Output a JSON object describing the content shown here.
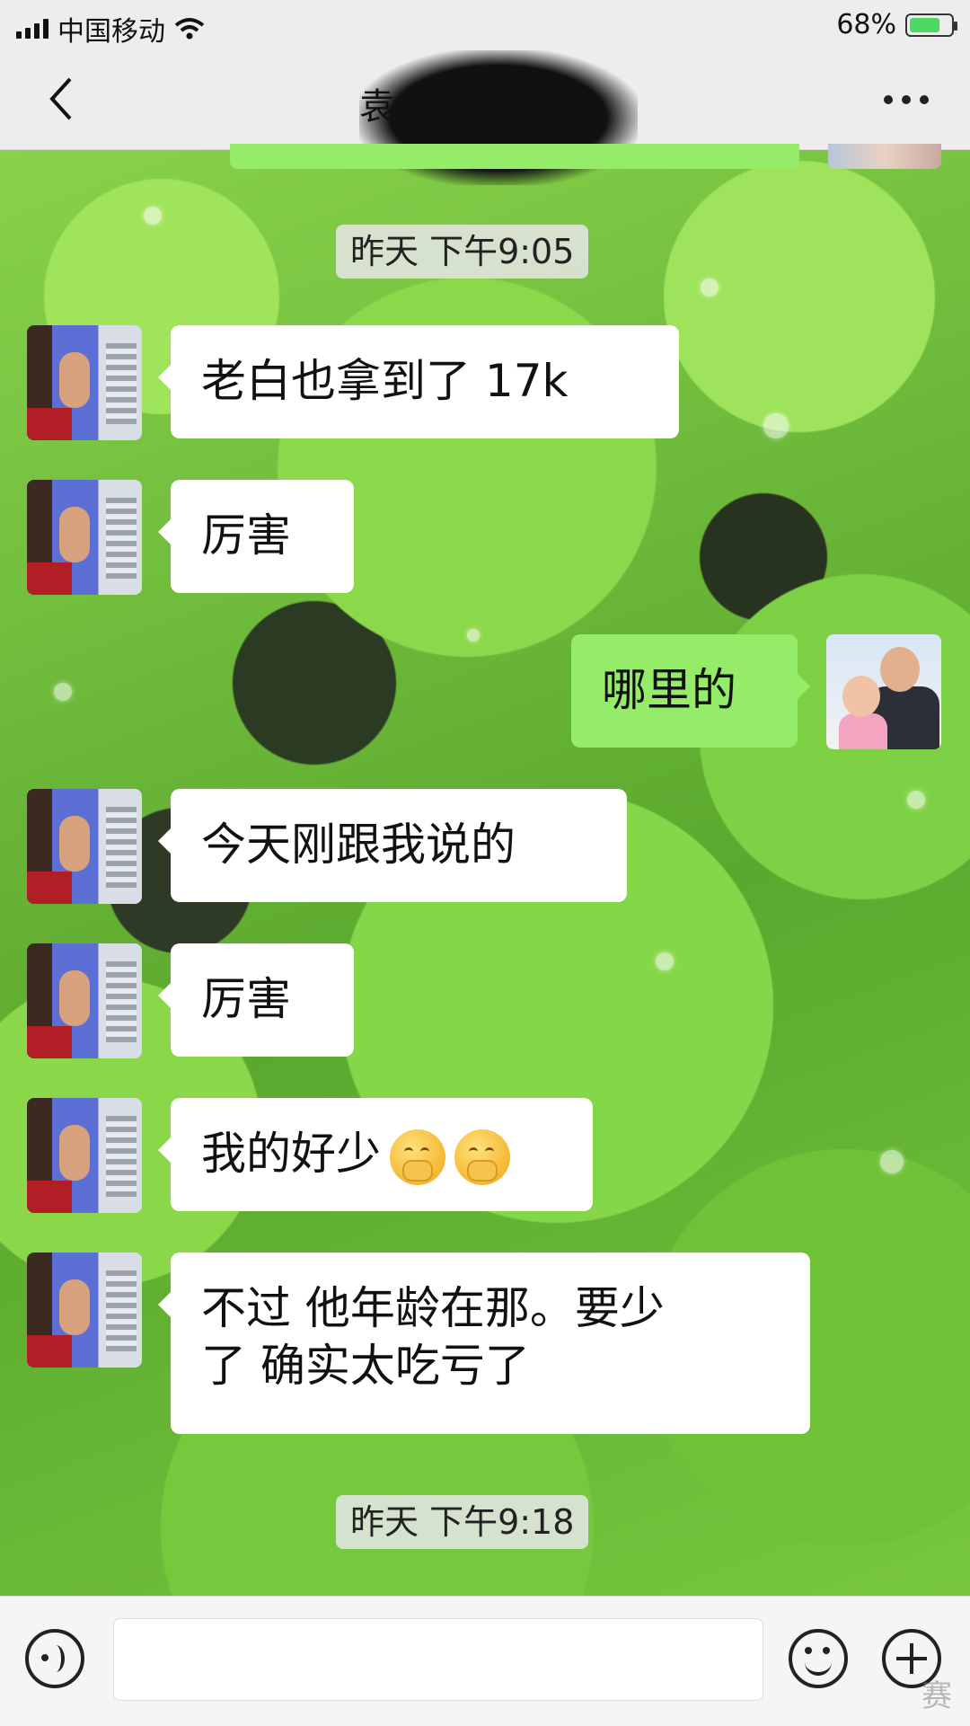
{
  "status_bar": {
    "carrier": "中国移动",
    "battery_percent": "68%",
    "wifi_icon": "wifi-icon",
    "battery_icon": "battery-charging-icon"
  },
  "nav": {
    "title": "袁",
    "back_icon": "chevron-left-icon",
    "more_icon": "more-horizontal-icon"
  },
  "messages": [
    {
      "type": "time",
      "text": "昨天 下午9:05"
    },
    {
      "type": "left",
      "text": "老白也拿到了 17k"
    },
    {
      "type": "left",
      "text": "厉害"
    },
    {
      "type": "right",
      "text": "哪里的"
    },
    {
      "type": "left",
      "text": "今天刚跟我说的"
    },
    {
      "type": "left",
      "text": "厉害"
    },
    {
      "type": "left",
      "text": "我的好少",
      "emojis": [
        "hand-over-mouth-emoji",
        "hand-over-mouth-emoji"
      ]
    },
    {
      "type": "left",
      "text_line1": "不过 他年龄在那。要少",
      "text_line2": "了 确实太吃亏了"
    },
    {
      "type": "time",
      "text": "昨天 下午9:18"
    }
  ],
  "input_bar": {
    "voice_icon": "voice-icon",
    "emoji_icon": "emoji-icon",
    "plus_icon": "plus-icon",
    "value": ""
  },
  "watermark": "赛"
}
